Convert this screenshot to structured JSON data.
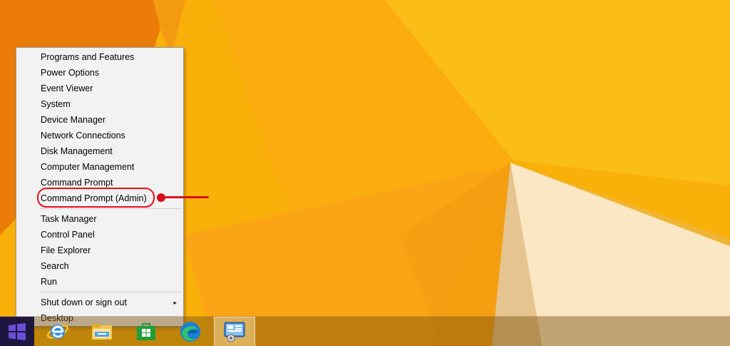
{
  "wallpaper": {
    "colors": {
      "base": "#f9b10a",
      "dark_orange": "#ec7c08",
      "light_orange": "#fba416",
      "bright_yellow": "#fbc51d",
      "cream": "#fbe9c8",
      "shadow": "#d9a33a"
    }
  },
  "context_menu": {
    "groups": [
      {
        "items": [
          {
            "label": "Programs and Features"
          },
          {
            "label": "Power Options"
          },
          {
            "label": "Event Viewer"
          },
          {
            "label": "System"
          },
          {
            "label": "Device Manager"
          },
          {
            "label": "Network Connections"
          },
          {
            "label": "Disk Management"
          },
          {
            "label": "Computer Management"
          },
          {
            "label": "Command Prompt"
          },
          {
            "label": "Command Prompt (Admin)",
            "highlighted": true
          }
        ]
      },
      {
        "items": [
          {
            "label": "Task Manager"
          },
          {
            "label": "Control Panel"
          },
          {
            "label": "File Explorer"
          },
          {
            "label": "Search"
          },
          {
            "label": "Run"
          }
        ]
      },
      {
        "items": [
          {
            "label": "Shut down or sign out",
            "has_submenu": true
          },
          {
            "label": "Desktop"
          }
        ]
      }
    ],
    "submenu_arrow": "▸"
  },
  "annotation": {
    "color": "#e8101e"
  },
  "taskbar": {
    "icons": [
      {
        "name": "start-button",
        "icon": "windows-logo-icon"
      },
      {
        "name": "internet-explorer",
        "icon": "internet-explorer-icon"
      },
      {
        "name": "file-explorer",
        "icon": "file-explorer-icon"
      },
      {
        "name": "windows-store",
        "icon": "store-icon"
      },
      {
        "name": "microsoft-edge",
        "icon": "edge-icon"
      },
      {
        "name": "control-panel",
        "icon": "control-panel-icon",
        "active": true
      }
    ]
  }
}
